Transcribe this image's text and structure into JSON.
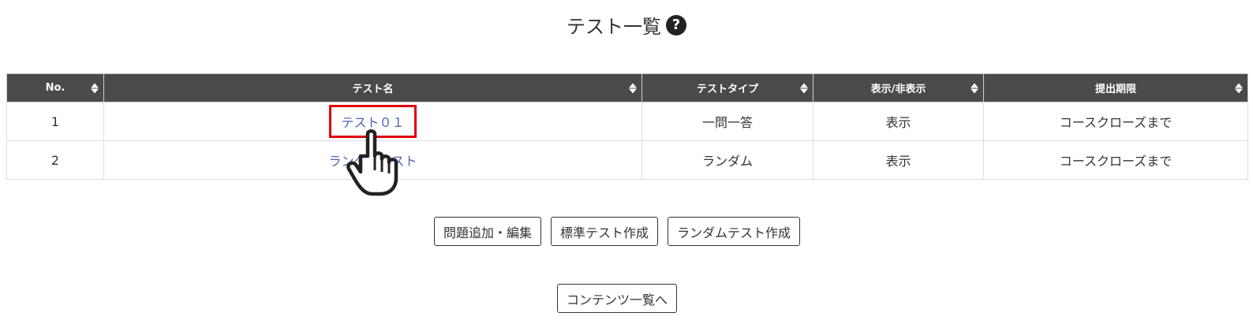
{
  "page": {
    "title": "テスト一覧",
    "help_icon": "?"
  },
  "table": {
    "headers": [
      {
        "label": "No."
      },
      {
        "label": "テスト名"
      },
      {
        "label": "テストタイプ"
      },
      {
        "label": "表示/非表示"
      },
      {
        "label": "提出期限"
      }
    ],
    "rows": [
      {
        "no": "1",
        "name": "テスト０１",
        "type": "一問一答",
        "visibility": "表示",
        "deadline": "コースクローズまで"
      },
      {
        "no": "2",
        "name": "ランダムテスト",
        "type": "ランダム",
        "visibility": "表示",
        "deadline": "コースクローズまで"
      }
    ]
  },
  "actions": {
    "edit_questions": "問題追加・編集",
    "create_standard": "標準テスト作成",
    "create_random": "ランダムテスト作成",
    "back_to_contents": "コンテンツ一覧へ"
  },
  "colors": {
    "header_bg": "#4a4a4a",
    "link": "#4a63b8",
    "highlight": "#e0000b"
  },
  "icons": [
    "help-icon",
    "sort-icon",
    "hand-pointer-icon"
  ]
}
